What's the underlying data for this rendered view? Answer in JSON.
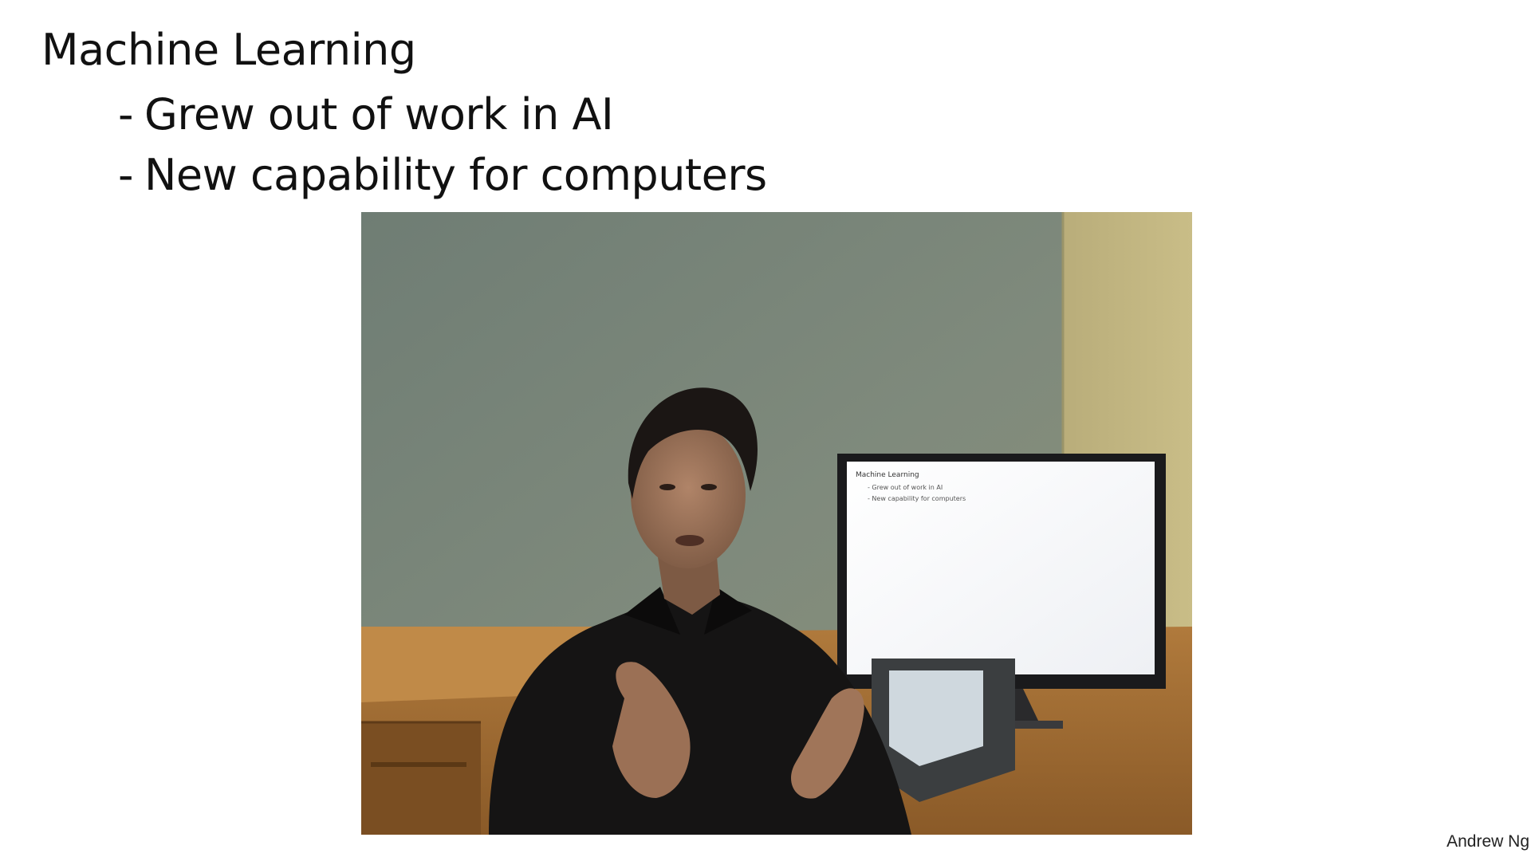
{
  "slide": {
    "title": "Machine Learning",
    "bullets": [
      {
        "dash": "-",
        "text": "Grew out of work in AI"
      },
      {
        "dash": "-",
        "text": "New capability for computers"
      }
    ],
    "author": "Andrew Ng"
  },
  "video": {
    "monitor_text": {
      "line1": "Machine Learning",
      "line2": "- Grew out of work in AI",
      "line3": "- New capability for computers"
    }
  }
}
